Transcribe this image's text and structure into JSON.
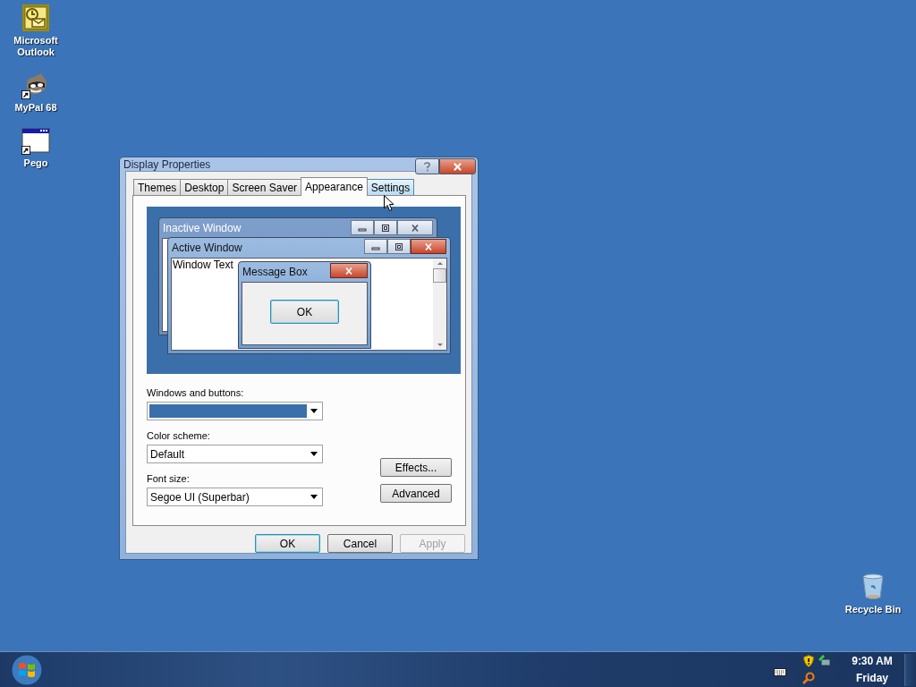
{
  "desktop_icons": [
    {
      "label": "Microsoft Outlook",
      "kind": "outlook",
      "shortcut": false
    },
    {
      "label": "MyPal 68",
      "kind": "raccoon",
      "shortcut": true
    },
    {
      "label": "Pego",
      "kind": "window",
      "shortcut": true
    }
  ],
  "recycle_bin": {
    "label": "Recycle Bin"
  },
  "dialog": {
    "title": "Display Properties",
    "tabs": [
      {
        "label": "Themes",
        "selected": false,
        "hovered": false
      },
      {
        "label": "Desktop",
        "selected": false,
        "hovered": false
      },
      {
        "label": "Screen Saver",
        "selected": false,
        "hovered": false
      },
      {
        "label": "Appearance",
        "selected": true,
        "hovered": false
      },
      {
        "label": "Settings",
        "selected": false,
        "hovered": true
      }
    ],
    "preview": {
      "inactive_window": {
        "title": "Inactive Window"
      },
      "active_window": {
        "title": "Active Window",
        "text": "Window Text"
      },
      "message_box": {
        "title": "Message Box",
        "button": "OK"
      }
    },
    "fields": [
      {
        "label": "Windows and buttons:",
        "kind": "swatch"
      },
      {
        "label": "Color scheme:",
        "kind": "text",
        "value": "Default"
      },
      {
        "label": "Font size:",
        "kind": "text",
        "value": "Segoe UI (Superbar)"
      }
    ],
    "side_buttons": [
      "Effects...",
      "Advanced"
    ],
    "buttons": [
      {
        "label": "OK",
        "default": true,
        "disabled": false
      },
      {
        "label": "Cancel",
        "default": false,
        "disabled": false
      },
      {
        "label": "Apply",
        "default": false,
        "disabled": true
      }
    ]
  },
  "taskbar": {
    "time": "9:30 AM",
    "day": "Friday"
  }
}
